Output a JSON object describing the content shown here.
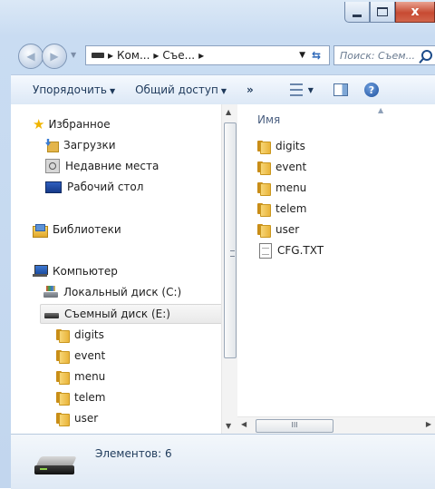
{
  "window": {
    "title_buttons": {
      "minimize": "minimize",
      "maximize": "maximize",
      "close": "x"
    }
  },
  "address": {
    "breadcrumbs": [
      "Ком...",
      "Съе..."
    ],
    "search_placeholder": "Поиск: Съем..."
  },
  "toolbar": {
    "organize": "Упорядочить",
    "share": "Общий доступ",
    "more": "»"
  },
  "nav": {
    "favorites": {
      "label": "Избранное",
      "items": [
        "Загрузки",
        "Недавние места",
        "Рабочий стол"
      ]
    },
    "libraries": "Библиотеки",
    "computer": {
      "label": "Компьютер",
      "drives": [
        "Локальный диск (C:)",
        "Съемный диск (E:)"
      ],
      "selected_drive_folders": [
        "digits",
        "event",
        "menu",
        "telem",
        "user"
      ]
    }
  },
  "files": {
    "column_header": "Имя",
    "items": [
      {
        "name": "digits",
        "type": "folder"
      },
      {
        "name": "event",
        "type": "folder"
      },
      {
        "name": "menu",
        "type": "folder"
      },
      {
        "name": "telem",
        "type": "folder"
      },
      {
        "name": "user",
        "type": "folder"
      },
      {
        "name": "CFG.TXT",
        "type": "text-file"
      }
    ],
    "hscroll_grip": "III"
  },
  "status": {
    "items_count": "Элементов: 6"
  },
  "colors": {
    "chrome": "#c9dcf2",
    "close_red": "#c74a32",
    "folder_yellow": "#f7d676"
  }
}
